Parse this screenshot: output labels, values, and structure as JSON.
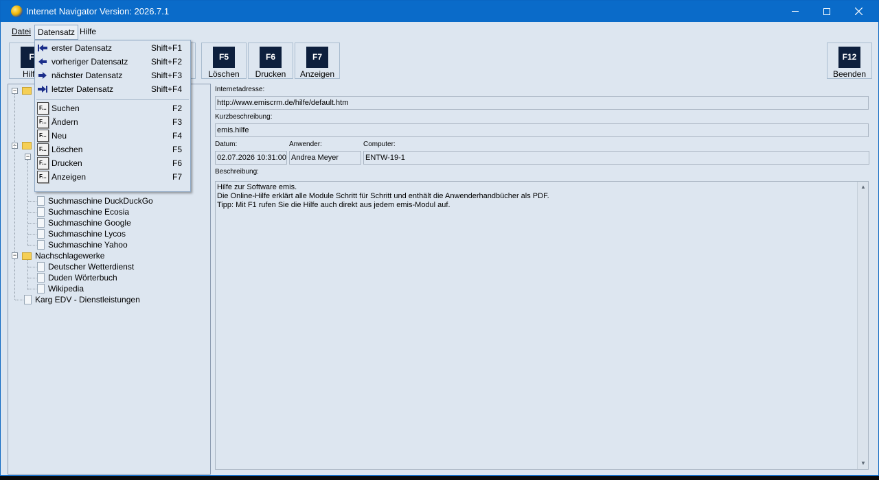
{
  "window": {
    "title": "Internet Navigator Version: 2026.7.1",
    "accent": "#0a6bc9"
  },
  "menubar": {
    "datei": "Datei",
    "datensatz": "Datensatz",
    "hilfe": "Hilfe"
  },
  "toolbar": {
    "left_partial": {
      "key": "F",
      "label": "Hilf"
    },
    "f5": {
      "key": "F5",
      "label": "Löschen"
    },
    "f6": {
      "key": "F6",
      "label": "Drucken"
    },
    "f7": {
      "key": "F7",
      "label": "Anzeigen"
    },
    "f12": {
      "key": "F12",
      "label": "Beenden"
    }
  },
  "dropdown": {
    "nav": [
      {
        "label": "erster Datensatz",
        "shortcut": "Shift+F1",
        "icon": "first-record-icon"
      },
      {
        "label": "vorheriger Datensatz",
        "shortcut": "Shift+F2",
        "icon": "previous-record-icon"
      },
      {
        "label": "nächster Datensatz",
        "shortcut": "Shift+F3",
        "icon": "next-record-icon"
      },
      {
        "label": "letzter Datensatz",
        "shortcut": "Shift+F4",
        "icon": "last-record-icon"
      }
    ],
    "fkey_icon_text": "F...",
    "actions": [
      {
        "label": "Suchen",
        "shortcut": "F2"
      },
      {
        "label": "Ändern",
        "shortcut": "F3"
      },
      {
        "label": "Neu",
        "shortcut": "F4"
      },
      {
        "label": "Löschen",
        "shortcut": "F5"
      },
      {
        "label": "Drucken",
        "shortcut": "F6"
      },
      {
        "label": "Anzeigen",
        "shortcut": "F7"
      }
    ]
  },
  "tree": {
    "visible_items": [
      "Suchmaschine DuckDuckGo",
      "Suchmaschine Ecosia",
      "Suchmaschine Google",
      "Suchmaschine Lycos",
      "Suchmaschine Yahoo"
    ],
    "nachschlagewerke": {
      "label": "Nachschlagewerke",
      "children": [
        "Deutscher Wetterdienst",
        "Duden Wörterbuch",
        "Wikipedia"
      ]
    },
    "karg": "Karg EDV - Dienstleistungen"
  },
  "form": {
    "url_label": "Internetadresse:",
    "url_value": "http://www.emiscrm.de/hilfe/default.htm",
    "short_label": "Kurzbeschreibung:",
    "short_value": "emis.hilfe",
    "date_label": "Datum:",
    "date_value": "02.07.2026 10:31:00",
    "user_label": "Anwender:",
    "user_value": "Andrea Meyer",
    "computer_label": "Computer:",
    "computer_value": "ENTW-19-1",
    "desc_label": "Beschreibung:",
    "desc_lines": [
      "Hilfe zur Software emis.",
      "Die Online-Hilfe erklärt alle Module Schritt für Schritt und enthält die Anwenderhandbücher als PDF.",
      "Tipp: Mit F1 rufen Sie die Hilfe auch direkt aus jedem emis-Modul auf."
    ]
  }
}
